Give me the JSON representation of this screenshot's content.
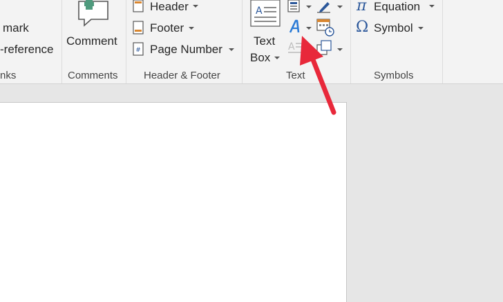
{
  "ribbon": {
    "links_group": {
      "bookmark_label": "mark",
      "crossref_label": "-reference",
      "group_label": "nks"
    },
    "comments_group": {
      "comment_label": "Comment",
      "group_label": "Comments"
    },
    "header_footer_group": {
      "header_label": "Header",
      "footer_label": "Footer",
      "page_number_label": "Page Number",
      "group_label": "Header & Footer"
    },
    "text_group": {
      "textbox_line1": "Text",
      "textbox_line2": "Box",
      "group_label": "Text"
    },
    "symbols_group": {
      "equation_label": "Equation",
      "symbol_label": "Symbol",
      "group_label": "Symbols",
      "equation_glyph": "π",
      "symbol_glyph": "Ω"
    }
  },
  "colors": {
    "ribbon_bg": "#f3f3f3",
    "doc_bg": "#e6e6e6",
    "accent_blue": "#2b579a",
    "comment_green": "#4f9a7d",
    "arrow_red": "#e8283a"
  }
}
